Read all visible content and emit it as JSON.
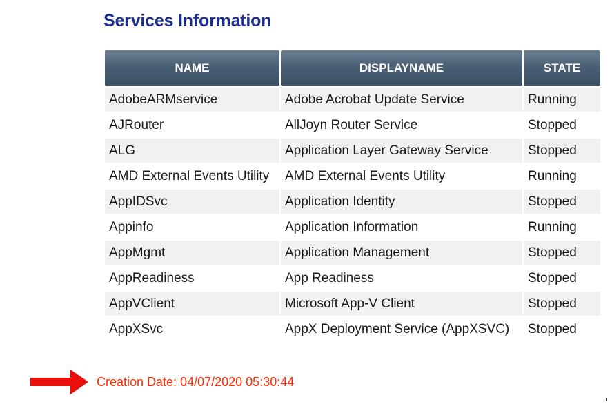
{
  "page": {
    "title": "Services Information",
    "creation_label": "Creation Date:",
    "creation_value": "04/07/2020 05:30:44"
  },
  "table": {
    "headers": [
      "NAME",
      "DISPLAYNAME",
      "STATE"
    ],
    "rows": [
      [
        "AdobeARMservice",
        "Adobe Acrobat Update Service",
        "Running"
      ],
      [
        "AJRouter",
        "AllJoyn Router Service",
        "Stopped"
      ],
      [
        "ALG",
        "Application Layer Gateway Service",
        "Stopped"
      ],
      [
        "AMD External Events Utility",
        "AMD External Events Utility",
        "Running"
      ],
      [
        "AppIDSvc",
        "Application Identity",
        "Stopped"
      ],
      [
        "Appinfo",
        "Application Information",
        "Running"
      ],
      [
        "AppMgmt",
        "Application Management",
        "Stopped"
      ],
      [
        "AppReadiness",
        "App Readiness",
        "Stopped"
      ],
      [
        "AppVClient",
        "Microsoft App-V Client",
        "Stopped"
      ],
      [
        "AppXSvc",
        "AppX Deployment Service (AppXSVC)",
        "Stopped"
      ]
    ]
  },
  "icons": {
    "arrow": "right-arrow-icon"
  },
  "colors": {
    "title": "#1d2f8f",
    "header_bg": "#4a5f74",
    "creation_text": "#ff2a00",
    "arrow": "#e8100c"
  }
}
